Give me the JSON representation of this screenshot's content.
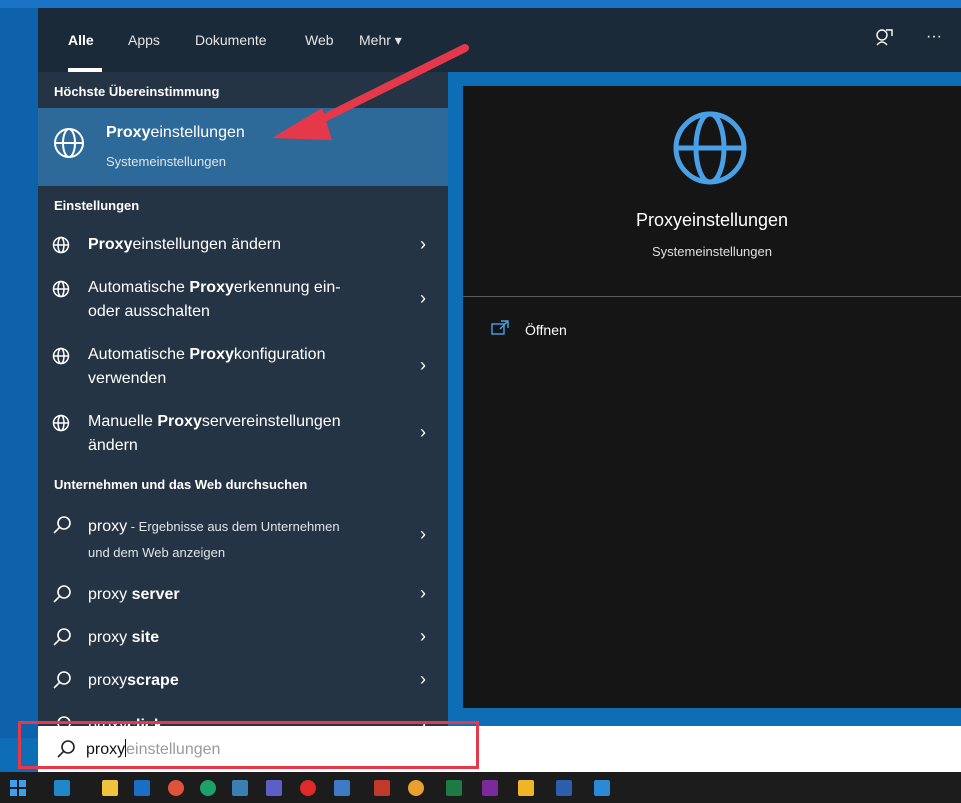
{
  "tabs": [
    "Alle",
    "Apps",
    "Dokumente",
    "Web",
    "Mehr"
  ],
  "sections": {
    "best": "Höchste Übereinstimmung",
    "settings": "Einstellungen",
    "web": "Unternehmen und das Web durchsuchen"
  },
  "best_match": {
    "bold": "Proxy",
    "rest": "einstellungen",
    "subtitle": "Systemeinstellungen"
  },
  "settings_items": [
    {
      "pre": "",
      "bold": "Proxy",
      "post": "einstellungen ändern"
    },
    {
      "pre": "Automatische ",
      "bold": "Proxy",
      "post": "erkennung ein-",
      "line2": "oder ausschalten"
    },
    {
      "pre": "Automatische ",
      "bold": "Proxy",
      "post": "konfiguration",
      "line2": "verwenden"
    },
    {
      "pre": "Manuelle ",
      "bold": "Proxy",
      "post": "servereinstellungen",
      "line2": "ändern"
    }
  ],
  "web_items": [
    {
      "term": "proxy",
      "suffix": " - Ergebnisse aus dem Unternehmen",
      "line2": "und dem Web anzeigen"
    },
    {
      "term": "proxy ",
      "bold": "server"
    },
    {
      "term": "proxy ",
      "bold": "site"
    },
    {
      "term": "proxy",
      "bold": "scrape"
    },
    {
      "term": "proxy",
      "bold": "click"
    }
  ],
  "preview": {
    "title": "Proxyeinstellungen",
    "subtitle": "Systemeinstellungen",
    "action": "Öffnen"
  },
  "search": {
    "typed": "proxy",
    "completion": "einstellungen"
  },
  "colors": {
    "accent": "#2d6a99",
    "annotation": "#e5384a",
    "icon_blue": "#4aa0e6"
  }
}
